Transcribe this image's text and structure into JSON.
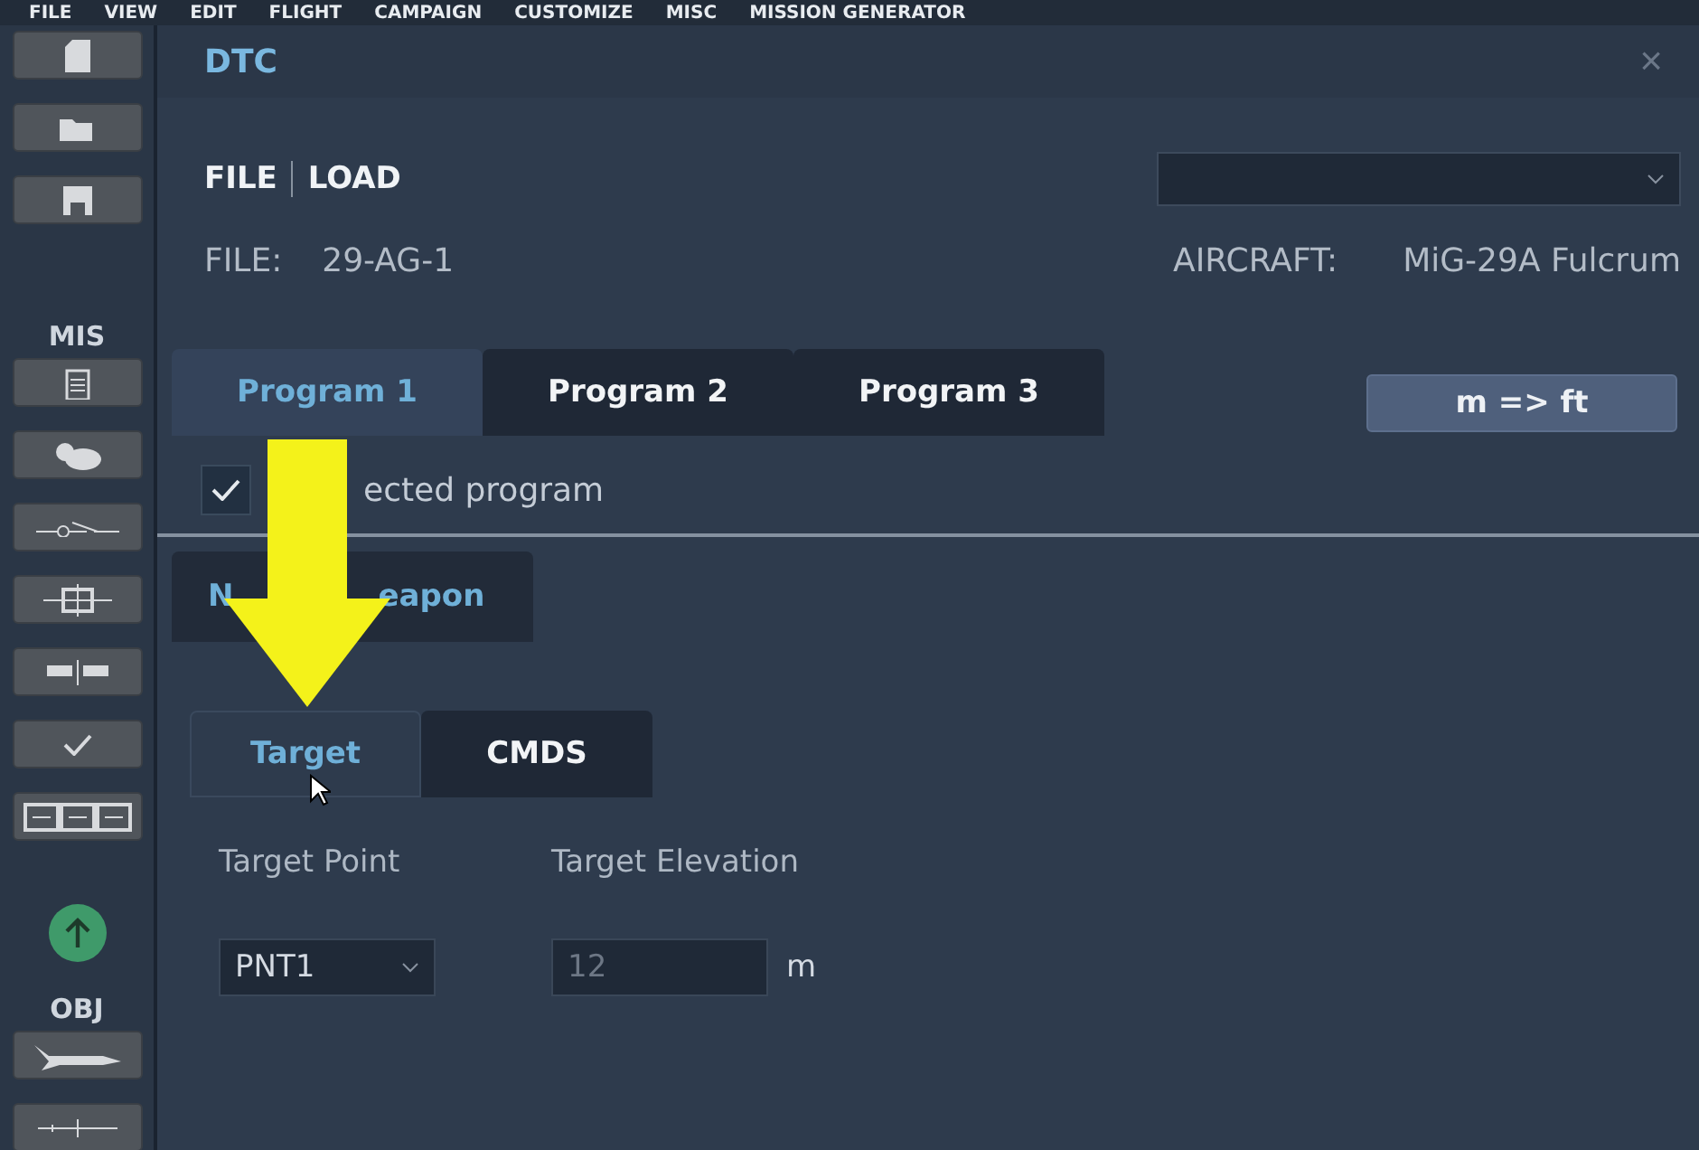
{
  "menu": [
    "FILE",
    "VIEW",
    "EDIT",
    "FLIGHT",
    "CAMPAIGN",
    "CUSTOMIZE",
    "MISC",
    "MISSION GENERATOR"
  ],
  "sidebar": {
    "headings": [
      "MIS",
      "OBJ"
    ]
  },
  "dialog": {
    "title": "DTC",
    "close": "×",
    "file_menu": [
      "FILE",
      "LOAD"
    ],
    "file_label": "FILE:",
    "file_value": "29-AG-1",
    "aircraft_label": "AIRCRAFT:",
    "aircraft_value": "MiG-29A Fulcrum",
    "program_tabs": [
      {
        "label": "Program 1",
        "selected": true
      },
      {
        "label": "Program 2",
        "selected": false
      },
      {
        "label": "Program 3",
        "selected": false
      }
    ],
    "convert_button": "m => ft",
    "selected_program": {
      "label": "ected program",
      "checked": true
    },
    "section_tab": {
      "label_start": "N",
      "label_end": "eapon",
      "selected": true
    },
    "sub_tabs": [
      {
        "label": "Target",
        "selected": true
      },
      {
        "label": "CMDS",
        "selected": false
      }
    ],
    "target_point": {
      "label": "Target Point",
      "value": "PNT1"
    },
    "target_elevation": {
      "label": "Target Elevation",
      "value": "12",
      "unit": "m"
    }
  }
}
